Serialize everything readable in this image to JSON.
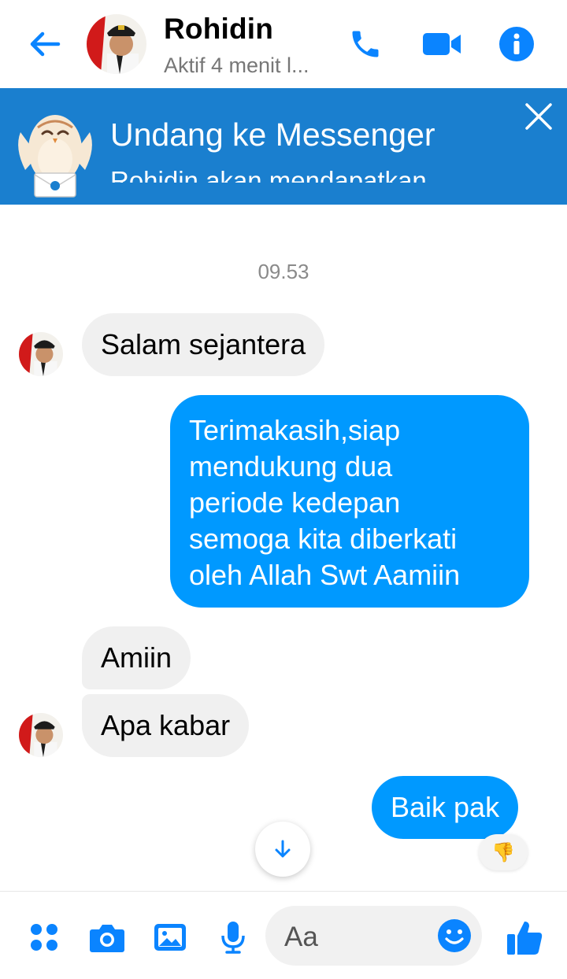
{
  "header": {
    "contact_name": "Rohidin",
    "status": "Aktif 4 menit l...",
    "icons": [
      "back-arrow-icon",
      "phone-icon",
      "video-camera-icon",
      "info-icon"
    ]
  },
  "banner": {
    "title": "Undang ke Messenger",
    "subtitle": "Rohidin akan mendapatkan",
    "close_icon": "close-icon"
  },
  "conversation": {
    "timestamp": "09.53",
    "messages": [
      {
        "sender": "contact",
        "text": "Salam sejantera"
      },
      {
        "sender": "me",
        "lines": [
          "Terimakasih,siap",
          "mendukung dua",
          "periode  kedepan",
          "semoga kita diberkati",
          "oleh Allah Swt Aamiin"
        ]
      },
      {
        "sender": "contact",
        "text": "Amiin"
      },
      {
        "sender": "contact",
        "text": "Apa kabar"
      },
      {
        "sender": "me",
        "text": "Baik pak"
      }
    ],
    "reaction": "👎"
  },
  "composer": {
    "placeholder": "Aa",
    "icons": [
      "apps-icon",
      "camera-icon",
      "gallery-icon",
      "microphone-icon",
      "emoji-icon",
      "thumbs-up-icon"
    ]
  },
  "colors": {
    "accent": "#0099ff",
    "banner": "#1a7fcf",
    "incoming_bubble": "#f0f0f0",
    "icon_blue": "#0a84ff"
  }
}
